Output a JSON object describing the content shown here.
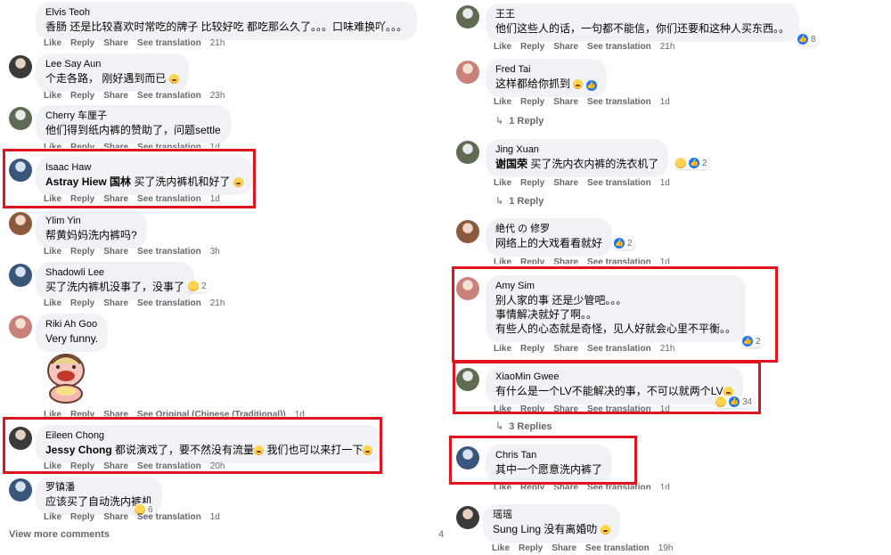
{
  "left": {
    "comments": [
      {
        "name": "Elvis Teoh",
        "text": "香肠 还是比较喜欢时常吃的牌子 比较好吃 都吃那么久了。。。口味难换吖。。。",
        "actions": [
          "Like",
          "Reply",
          "Share",
          "See translation"
        ],
        "time": "21h"
      },
      {
        "name": "Lee Say Aun",
        "text": "个走各路， 刚好遇到而已",
        "actions": [
          "Like",
          "Reply",
          "Share",
          "See translation"
        ],
        "time": "23h"
      },
      {
        "name": "Cherry 车厘子",
        "text": "他们得到纸内裤的赞助了，问题settle",
        "actions": [
          "Like",
          "Reply",
          "Share",
          "See translation"
        ],
        "time": "1d"
      },
      {
        "name": "Isaac Haw",
        "mention": "Astray Hiew 国林",
        "text": "买了洗内裤机和好了",
        "actions": [
          "Like",
          "Reply",
          "Share",
          "See translation"
        ],
        "time": "1d"
      },
      {
        "name": "Ylim Yin",
        "text": "帮黄妈妈洗内裤吗?",
        "actions": [
          "Like",
          "Reply",
          "Share",
          "See translation"
        ],
        "time": "3h"
      },
      {
        "name": "Shadowli Lee",
        "text": "买了洗内裤机没事了，没事了",
        "actions": [
          "Like",
          "Reply",
          "Share",
          "See translation"
        ],
        "time": "21h",
        "reactions": "2"
      },
      {
        "name": "Riki Ah Goo",
        "text": "Very funny.",
        "actions": [
          "Like",
          "Reply",
          "Share",
          "See Original (Chinese (Traditional))"
        ],
        "time": "1d"
      },
      {
        "name": "Eileen Chong",
        "mention": "Jessy Chong",
        "text": "都说演戏了，要不然没有流量",
        "text2": "我们也可以来打一下",
        "actions": [
          "Like",
          "Reply",
          "Share",
          "See translation"
        ],
        "time": "20h"
      },
      {
        "name": "罗镇潘",
        "text": "应该买了自动洗内裤机",
        "actions": [
          "Like",
          "Reply",
          "Share",
          "See translation"
        ],
        "time": "1d",
        "reactions": "6"
      }
    ],
    "view_more": "View more comments",
    "view_more_count": "4"
  },
  "right": {
    "comments": [
      {
        "name": "王王",
        "text": "他们这些人的话，一句都不能信，你们还要和这种人买东西。。",
        "actions": [
          "Like",
          "Reply",
          "Share",
          "See translation"
        ],
        "time": "21h",
        "reactions": "8"
      },
      {
        "name": "Fred Tai",
        "text": "这样都给你抓到",
        "actions": [
          "Like",
          "Reply",
          "Share",
          "See translation"
        ],
        "time": "1d",
        "replies": "1 Reply"
      },
      {
        "name": "Jing Xuan",
        "mention": "谢国荣",
        "text": "买了洗内衣内裤的洗衣机了",
        "actions": [
          "Like",
          "Reply",
          "Share",
          "See translation"
        ],
        "time": "1d",
        "reactions": "2",
        "replies": "1 Reply"
      },
      {
        "name": "絶代 の 修罗",
        "text": "网络上的大戏看看就好",
        "actions": [
          "Like",
          "Reply",
          "Share",
          "See translation"
        ],
        "time": "1d",
        "reactions": "2"
      },
      {
        "name": "Amy Sim",
        "lines": [
          "别人家的事 还是少管吧。。。",
          "事情解决就好了啊。。",
          "有些人的心态就是奇怪，见人好就会心里不平衡。。"
        ],
        "actions": [
          "Like",
          "Reply",
          "Share",
          "See translation"
        ],
        "time": "21h",
        "reactions": "2"
      },
      {
        "name": "XiaoMin Gwee",
        "text": "有什么是一个LV不能解决的事，不可以就两个LV",
        "actions": [
          "Like",
          "Reply",
          "Share",
          "See translation"
        ],
        "time": "1d",
        "reactions": "34",
        "replies": "3 Replies"
      },
      {
        "name": "Chris Tan",
        "text": "其中一个愿意洗内裤了",
        "actions": [
          "Like",
          "Reply",
          "Share",
          "See translation"
        ],
        "time": "1d"
      },
      {
        "name": "瑶瑶",
        "mention": "Sung Ling",
        "text": "没有离婚叻",
        "actions": [
          "Like",
          "Reply",
          "Share",
          "See translation"
        ],
        "time": "19h"
      }
    ]
  },
  "colors": {
    "highlight": "#e0141e",
    "bubble": "#f0f2f5",
    "like": "#1877f2",
    "meta": "#65676b"
  }
}
